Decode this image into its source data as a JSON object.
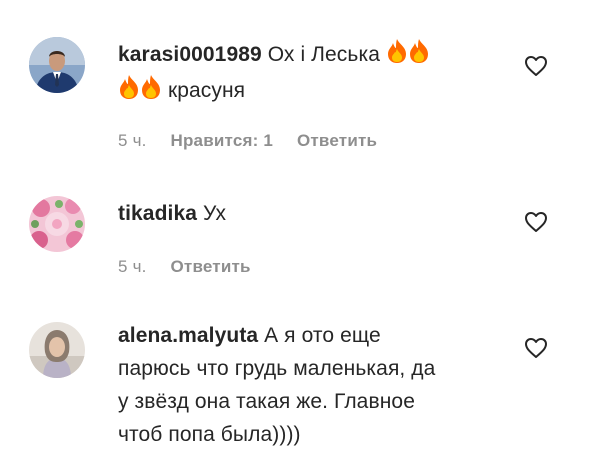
{
  "comments": [
    {
      "username": "karasi0001989",
      "text_line1": "Ох і Леська",
      "text_line2": "красуня",
      "emoji": "fire",
      "time": "5 ч.",
      "likes": "Нравится: 1",
      "reply": "Ответить",
      "avatar_icon": "person-in-suit-avatar",
      "like_icon": "heart-outline-icon"
    },
    {
      "username": "tikadika",
      "text": "Ух",
      "time": "5 ч.",
      "reply": "Ответить",
      "avatar_icon": "pink-flowers-avatar",
      "like_icon": "heart-outline-icon"
    },
    {
      "username": "alena.malyuta",
      "text_lines": [
        "А я ото еще",
        "парюсь что грудь маленькая, да",
        "у звёзд она такая же. Главное",
        "чтоб попа была))))"
      ],
      "avatar_icon": "woman-photo-avatar",
      "like_icon": "heart-outline-icon"
    }
  ],
  "colors": {
    "text": "#262626",
    "muted": "#8e8e8e",
    "fire_outer": "#ff6a00",
    "fire_inner": "#ffc400"
  }
}
